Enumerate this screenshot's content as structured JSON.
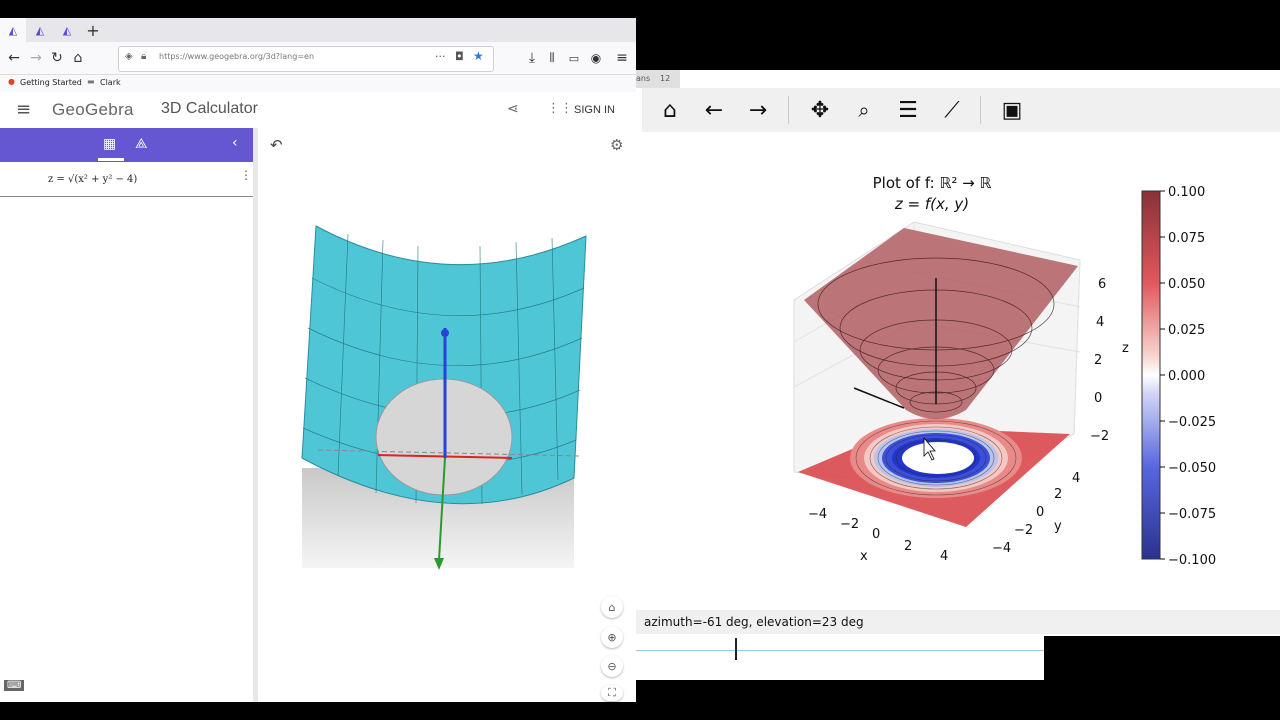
{
  "browser": {
    "tabs": [
      "",
      "",
      ""
    ],
    "url": "https://www.geogebra.org/3d?lang=en",
    "bookmarks": [
      "Getting Started",
      "Clark"
    ]
  },
  "geogebra": {
    "logo": "GeoGebra",
    "app_title": "3D Calculator",
    "sign_in": "SIGN IN",
    "expression": "z = √(x² + y² − 4)",
    "accent": "#6557d2",
    "surface_color": "#4fc6d6"
  },
  "matplotlib": {
    "tab_label": "ans",
    "tab_number": "12",
    "status": "azimuth=-61 deg, elevation=23 deg"
  },
  "chart_data": {
    "type": "surface3d",
    "title_line1": "Plot of f: ℝ² → ℝ",
    "title_line2": "z = f(x, y)",
    "function": "z = sqrt(x^2 + y^2 - 4)",
    "xlabel": "x",
    "ylabel": "y",
    "zlabel": "z",
    "x_ticks": [
      "−4",
      "−2",
      "0",
      "2",
      "4"
    ],
    "y_ticks": [
      "4",
      "2",
      "0",
      "−2",
      "−4"
    ],
    "z_ticks": [
      "6",
      "4",
      "2",
      "0",
      "−2"
    ],
    "xlim": [
      -4,
      4
    ],
    "ylim": [
      -4,
      4
    ],
    "zlim": [
      -3,
      7
    ],
    "colorbar": {
      "ticks": [
        "0.100",
        "0.075",
        "0.050",
        "0.025",
        "0.000",
        "−0.025",
        "−0.050",
        "−0.075",
        "−0.100"
      ],
      "range": [
        -0.1,
        0.1
      ],
      "colormap": "seismic"
    },
    "view": {
      "azimuth": -61,
      "elevation": 23
    }
  }
}
